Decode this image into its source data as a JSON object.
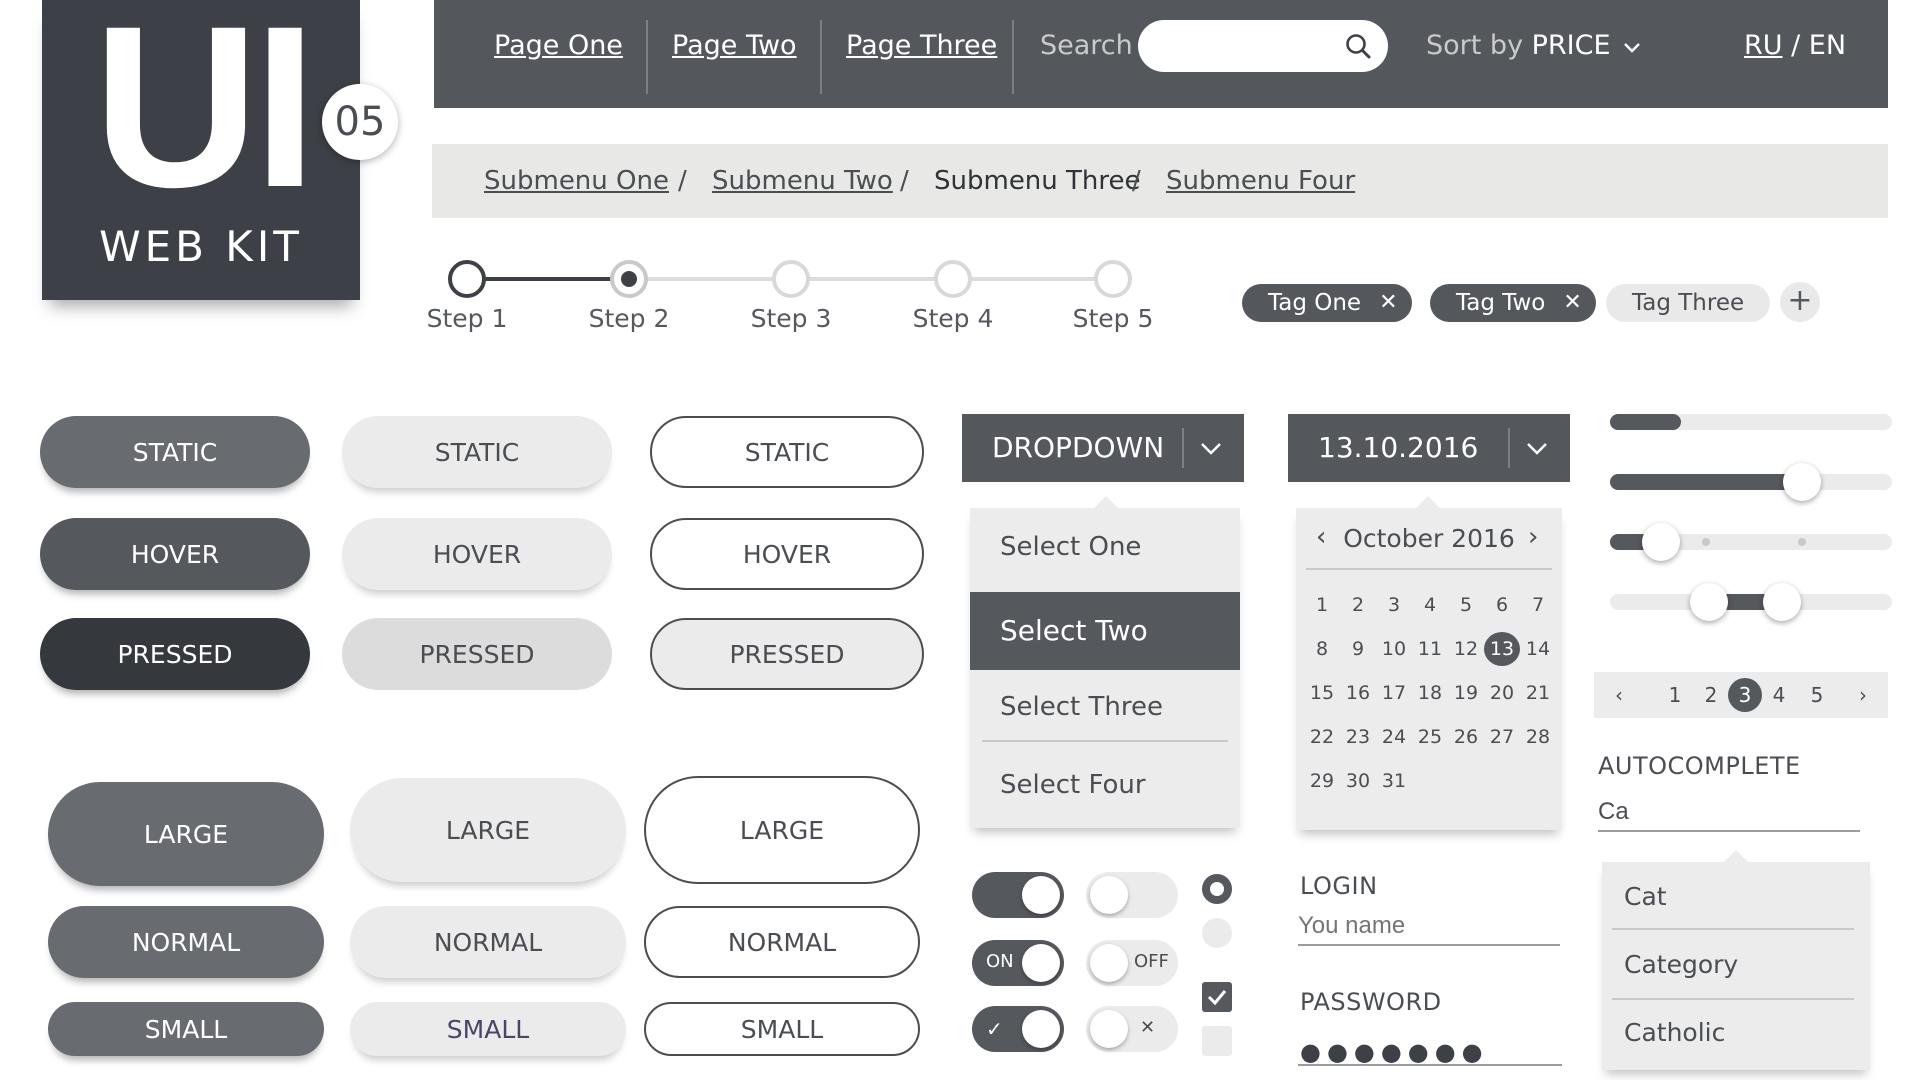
{
  "logo": {
    "mark": "UI",
    "subtitle": "WEB KIT",
    "badge": "05"
  },
  "nav": {
    "links": [
      "Page One",
      "Page Two",
      "Page Three"
    ],
    "search_label": "Search",
    "search_value": "",
    "sort_prefix": "Sort by",
    "sort_value": "PRICE",
    "lang_ru": "RU",
    "lang_sep": " / ",
    "lang_en": "EN"
  },
  "breadcrumb": {
    "items": [
      "Submenu One",
      "Submenu Two",
      "Submenu Three",
      "Submenu Four"
    ],
    "separator": "/"
  },
  "stepper": {
    "steps": [
      "Step 1",
      "Step 2",
      "Step 3",
      "Step 4",
      "Step 5"
    ],
    "progress_percent": 25
  },
  "tags": {
    "items": [
      "Tag One",
      "Tag Two",
      "Tag Three"
    ],
    "remove_glyph": "✕",
    "add_glyph": "+"
  },
  "buttons": {
    "states": [
      "STATIC",
      "HOVER",
      "PRESSED"
    ],
    "sizes": [
      "LARGE",
      "NORMAL",
      "SMALL"
    ]
  },
  "dropdown": {
    "label": "DROPDOWN",
    "options": [
      "Select One",
      "Select Two",
      "Select Three",
      "Select Four"
    ],
    "selected": "Select Two"
  },
  "datepicker": {
    "value": "13.10.2016",
    "month": "October 2016",
    "prev": "‹",
    "next": "›",
    "days": [
      "1",
      "2",
      "3",
      "4",
      "5",
      "6",
      "7",
      "8",
      "9",
      "10",
      "11",
      "12",
      "13",
      "14",
      "15",
      "16",
      "17",
      "18",
      "19",
      "20",
      "21",
      "22",
      "23",
      "24",
      "25",
      "26",
      "27",
      "28",
      "29",
      "30",
      "31"
    ],
    "today": "13"
  },
  "sliders": {
    "progress_1": 0.25,
    "progress_2": 0.68,
    "single_value": 0.18,
    "range_low": 0.35,
    "range_high": 0.61
  },
  "pagination": {
    "prev": "‹",
    "next": "›",
    "pages": [
      "1",
      "2",
      "3",
      "4",
      "5"
    ],
    "current": "3"
  },
  "autocomplete": {
    "label": "AUTOCOMPLETE",
    "value": "Ca",
    "suggestions": [
      "Cat",
      "Category",
      "Catholic"
    ]
  },
  "login": {
    "login_label": "LOGIN",
    "login_placeholder": "You name",
    "password_label": "PASSWORD",
    "password_mask": "●●●●●●●"
  },
  "toggles": {
    "on_text": "ON",
    "off_text": "OFF",
    "check_glyph": "✓",
    "x_glyph": "✕"
  },
  "colors": {
    "dark": "#54575c",
    "darker": "#35383c",
    "light": "#ebebeb",
    "accent_text": "#ffffff"
  }
}
